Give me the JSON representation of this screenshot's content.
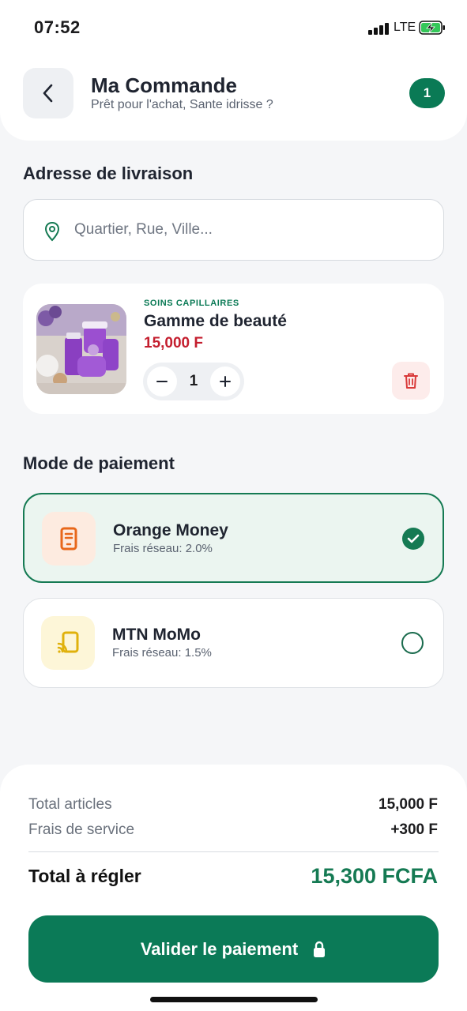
{
  "status_bar": {
    "time": "07:52",
    "network": "LTE"
  },
  "header": {
    "title": "Ma Commande",
    "subtitle": "Prêt pour l'achat, Sante idrisse ?",
    "cart_count": "1"
  },
  "address": {
    "section_title": "Adresse de livraison",
    "value": "",
    "placeholder": "Quartier, Rue, Ville..."
  },
  "product": {
    "category": "SOINS CAPILLAIRES",
    "name": "Gamme de beauté",
    "price": "15,000 F",
    "quantity": "1"
  },
  "payment": {
    "section_title": "Mode de paiement",
    "methods": [
      {
        "name": "Orange Money",
        "fee": "Frais réseau: 2.0%",
        "selected": true,
        "icon": "phone-icon",
        "color": "#e8671a"
      },
      {
        "name": "MTN MoMo",
        "fee": "Frais réseau: 1.5%",
        "selected": false,
        "icon": "mobile-payment-icon",
        "color": "#e0b10c"
      }
    ]
  },
  "summary": {
    "items_label": "Total articles",
    "items_value": "15,000 F",
    "service_label": "Frais de service",
    "service_value": "+300 F",
    "total_label": "Total à régler",
    "total_value": "15,300 FCFA",
    "button_label": "Valider le paiement"
  },
  "colors": {
    "primary": "#0b7a57",
    "price": "#c41e2e"
  }
}
